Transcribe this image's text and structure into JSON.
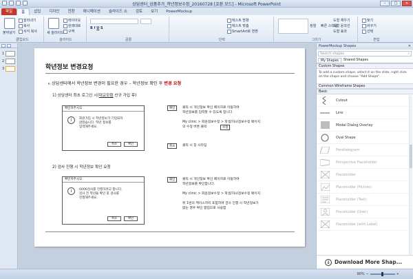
{
  "window": {
    "title": "상담센터_상품추가_학년정보수정_20160728 [호환 모드] - Microsoft PowerPoint",
    "min": "–",
    "max": "□",
    "close": "✕"
  },
  "ribbon_tabs": [
    "파일",
    "홈",
    "삽입",
    "디자인",
    "전환",
    "애니메이션",
    "슬라이드 쇼",
    "검토",
    "보기",
    "PowerMockup"
  ],
  "ribbon": {
    "clipboard": {
      "paste": "붙여넣기",
      "cut": "잘라내기",
      "copy": "복사",
      "format": "서식 복사",
      "label": "클립보드"
    },
    "slides": {
      "new": "새 슬라이드",
      "layout": "레이아웃",
      "reset": "원래대로",
      "section": "구역",
      "label": "슬라이드"
    },
    "font": {
      "label": "글꼴"
    },
    "paragraph": {
      "direction": "텍스트 방향",
      "align": "텍스트 맞춤",
      "smartart": "SmartArt로 변환",
      "label": "단락"
    },
    "drawing": {
      "arrange": "정렬",
      "styles": "빠른 스타일",
      "fill": "도형 채우기",
      "outline": "도형 윤곽선",
      "effects": "도형 효과",
      "label": "그리기"
    },
    "editing": {
      "find": "찾기",
      "replace": "바꾸기",
      "select": "선택",
      "label": "편집"
    }
  },
  "thumbnails": [
    "1",
    "2",
    "3"
  ],
  "slide": {
    "title": "학년정보 변경요청",
    "bullet_main": "상담센터에서 학년정보 변경이 필요한 경우 – 학년정보 확인 후 ",
    "bullet_red": "변경 요청",
    "step1_pre": "1) 상담센터 최초 로그인 시(",
    "step1_u": "대교모험",
    "step1_post": " 신규 가입 후)",
    "step2": "2) 검사 진행 시 학년정보 확인 요청",
    "dialog1": {
      "title": "확인하주시오.",
      "msg": [
        "회원가입 시 학년정보가 기입되지",
        "않았습니다. 학년 정보를",
        "입력해주세요."
      ],
      "cancel": "취소",
      "ok": "확인"
    },
    "dialog2": {
      "title": "확인하주시오.",
      "msg": [
        "0000검사를 진행하려고 합니다.",
        "검사 전 학년을 확인 후 검사를",
        "진행해주세요."
      ],
      "cancel": "취소",
      "ok": "확인"
    },
    "note1": {
      "chip": "확인",
      "line1": "클릭 시 개인정보 확인 페이지로 이동하여",
      "line2": "학년정보를 입력할 수 있도록 합니다.",
      "line3": "My clinic > 회원정보수정 > 학생/자녀정보수정  페이지",
      "line4": "의 수정 버튼 클릭",
      "edit_chip": "수정"
    },
    "note_cancel": {
      "chip": "취소",
      "text": "클릭 시 창 사라짐"
    },
    "note2": {
      "chip": "확인",
      "line1": "클릭 시 개인정보 확인 페이지로 이동하여",
      "line2": "학년정보를 확인합니다.",
      "line3": "My clinic > 회원정보수정 > 학생/자녀정보수정  페이지",
      "line4": "위 1번의 케이스까지 포함하여 검사 진행 시 학년정보가",
      "line5": "없는 경우 확인 팝업으로 사용함"
    }
  },
  "panel": {
    "header": "PowerMockup Shapes",
    "search_placeholder": "Search shapes",
    "tabs": [
      "My Shapes",
      "Shared Shapes"
    ],
    "custom_section": "Custom Shapes",
    "custom_help": "To add a custom shape, select it on the slide, right click on the shape and choose \"Add Shape\".",
    "wireframe_section": "Common Wireframe Shapes",
    "basic_section": "Basic",
    "shapes": [
      "Cutout",
      "Line",
      "Modal Dialog Overlay",
      "Oval Shape",
      "Parallelogram",
      "Perspective Placeholder",
      "Placeholder",
      "Placeholder (Picture)",
      "Placeholder (Text)",
      "Placeholder (User)",
      "Placeholder (with Label)"
    ],
    "download": "Download  More Shap..."
  },
  "status": {
    "zoom": "90%"
  }
}
